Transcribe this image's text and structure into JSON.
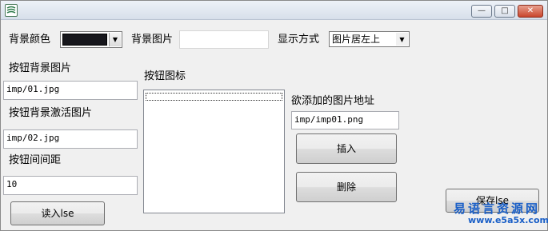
{
  "window": {
    "controls": {
      "minimize": "—",
      "maximize": "□",
      "close": "✕"
    }
  },
  "labels": {
    "bg_color": "背景颜色",
    "bg_image": "背景图片",
    "display_mode": "显示方式",
    "button_bg_image": "按钮背景图片",
    "button_icon": "按钮图标",
    "button_active_image": "按钮背景激活图片",
    "button_spacing": "按钮间间距",
    "add_image_path": "欲添加的图片地址"
  },
  "fields": {
    "bg_color_value": "#17171c",
    "bg_image_value": "",
    "display_mode_value": "图片居左上",
    "button_bg_image_value": "imp/01.jpg",
    "button_active_image_value": "imp/02.jpg",
    "button_spacing_value": "10",
    "add_image_path_value": "imp/imp01.png"
  },
  "buttons": {
    "insert": "插入",
    "delete": "删除",
    "read": "读入lse",
    "save": "保存lse"
  },
  "watermark": {
    "name": "易语言资源网",
    "url": "www.e5a5x.com"
  },
  "colors": {
    "window_bg": "#f0f0f0",
    "watermark": "#1a5fc7",
    "close_button": "#c9452c"
  }
}
